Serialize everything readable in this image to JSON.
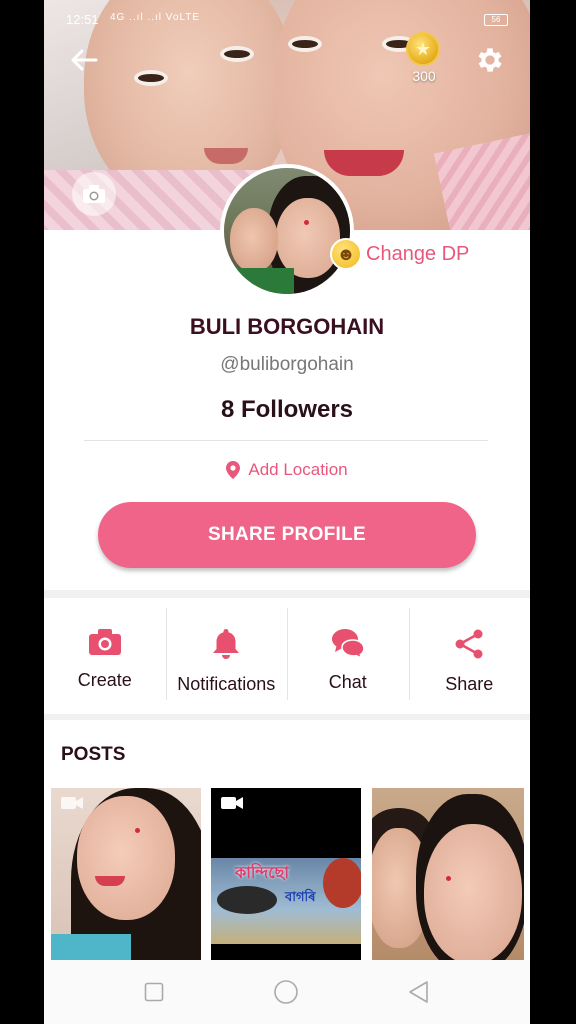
{
  "status_bar": {
    "time": "12:51",
    "signal_text": "4G ..ıl ..ıl VoLTE",
    "battery": "56"
  },
  "header": {
    "back_icon": "arrow-left-icon",
    "coin_count": "300",
    "settings_icon": "gear-icon",
    "cover_camera_icon": "camera-icon"
  },
  "profile": {
    "change_dp_label": "Change DP",
    "name": "BULI BORGOHAIN",
    "handle": "@buliborgohain",
    "followers": "8 Followers",
    "location_label": "Add Location",
    "share_button": "SHARE PROFILE"
  },
  "actions": [
    {
      "label": "Create",
      "icon": "camera-icon"
    },
    {
      "label": "Notifications",
      "icon": "bell-icon"
    },
    {
      "label": "Chat",
      "icon": "chat-bubbles-icon"
    },
    {
      "label": "Share",
      "icon": "share-icon"
    }
  ],
  "posts": {
    "heading": "POSTS",
    "items": [
      {
        "type": "video",
        "icon": "video-camera-icon"
      },
      {
        "type": "video",
        "icon": "video-camera-icon",
        "overlay_text_1": "কান্দিছো",
        "overlay_text_2": "বাগৰি"
      },
      {
        "type": "image"
      }
    ]
  },
  "colors": {
    "accent": "#f0648a",
    "accent_text": "#e9577d",
    "name_text": "#3a1020"
  }
}
